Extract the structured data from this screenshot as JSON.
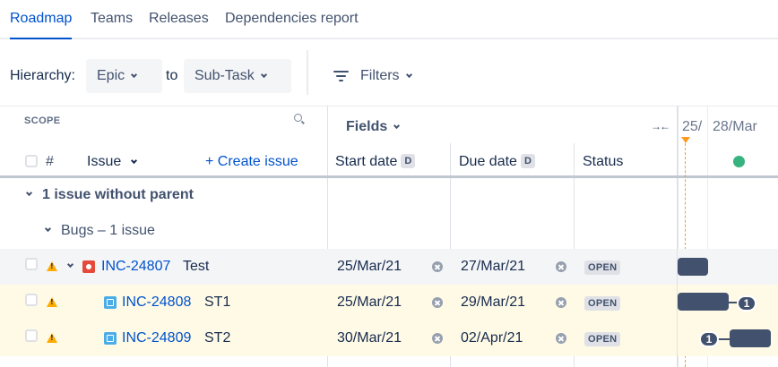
{
  "tabs": [
    {
      "label": "Roadmap",
      "active": true
    },
    {
      "label": "Teams"
    },
    {
      "label": "Releases"
    },
    {
      "label": "Dependencies report"
    }
  ],
  "toolbar": {
    "hierarchy_label": "Hierarchy:",
    "from_value": "Epic",
    "to_label": "to",
    "to_value": "Sub-Task",
    "filters_label": "Filters"
  },
  "scope": {
    "title": "SCOPE",
    "col_number": "#",
    "col_issue": "Issue",
    "create_issue": "+ Create issue"
  },
  "fields": {
    "label": "Fields",
    "col_start": "Start date",
    "col_start_badge": "D",
    "col_due": "Due date",
    "col_due_badge": "D",
    "col_status": "Status"
  },
  "timeline": {
    "date_labels": [
      "25/",
      "28/Mar"
    ],
    "today_color": "#ff991f",
    "release_color": "#36b37e",
    "bar_color": "#42526e"
  },
  "groups": {
    "without_parent": "1 issue without parent",
    "bugs": "Bugs – 1 issue"
  },
  "rows": [
    {
      "key": "INC-24807",
      "summary": "Test",
      "start": "25/Mar/21",
      "due": "27/Mar/21",
      "status": "OPEN",
      "type": "bug-icon",
      "dependency": ""
    },
    {
      "key": "INC-24808",
      "summary": "ST1",
      "start": "25/Mar/21",
      "due": "29/Mar/21",
      "status": "OPEN",
      "type": "subtask-icon",
      "dependency": "1"
    },
    {
      "key": "INC-24809",
      "summary": "ST2",
      "start": "30/Mar/21",
      "due": "02/Apr/21",
      "status": "OPEN",
      "type": "subtask-icon",
      "dependency": "1"
    }
  ]
}
